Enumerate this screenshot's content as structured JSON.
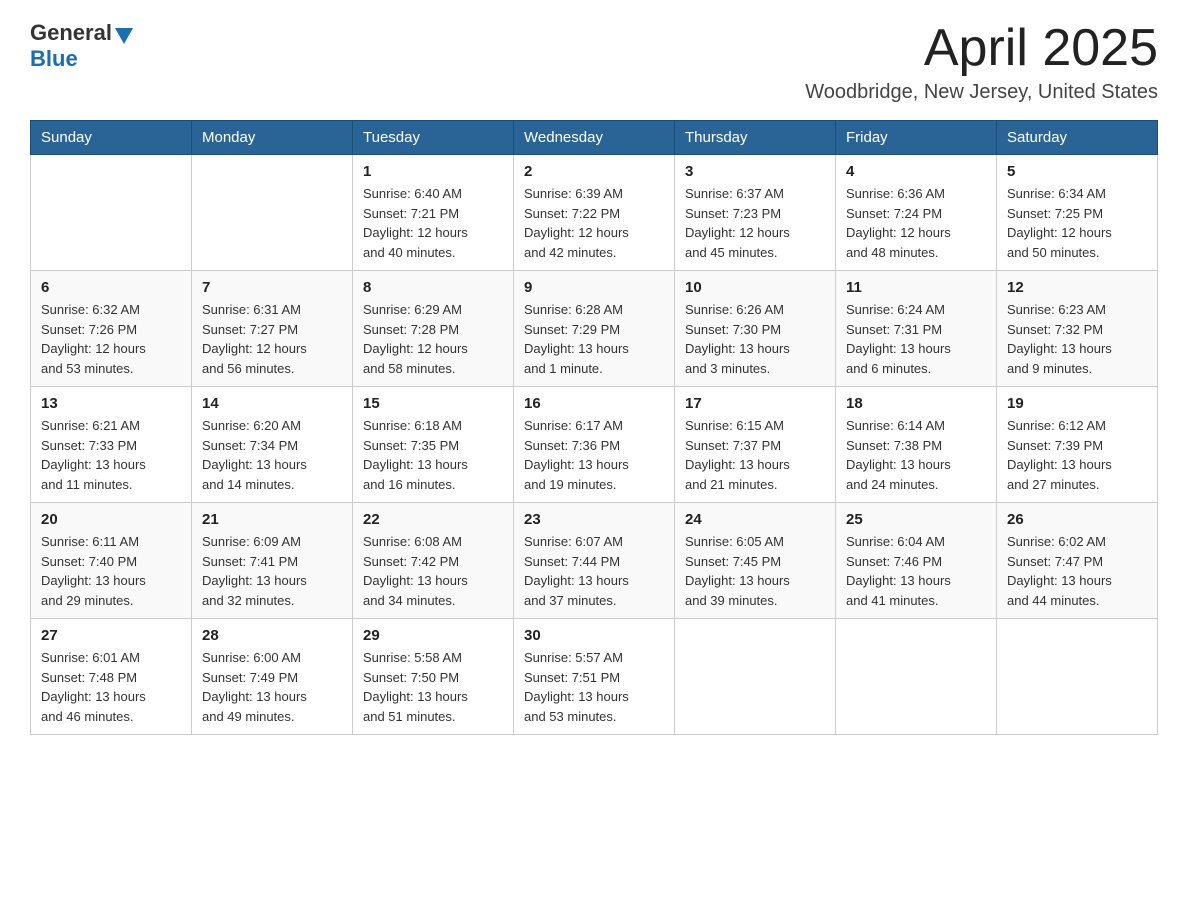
{
  "header": {
    "logo_general": "General",
    "logo_blue": "Blue",
    "title": "April 2025",
    "subtitle": "Woodbridge, New Jersey, United States"
  },
  "days_of_week": [
    "Sunday",
    "Monday",
    "Tuesday",
    "Wednesday",
    "Thursday",
    "Friday",
    "Saturday"
  ],
  "weeks": [
    [
      {
        "day": "",
        "info": ""
      },
      {
        "day": "",
        "info": ""
      },
      {
        "day": "1",
        "info": "Sunrise: 6:40 AM\nSunset: 7:21 PM\nDaylight: 12 hours\nand 40 minutes."
      },
      {
        "day": "2",
        "info": "Sunrise: 6:39 AM\nSunset: 7:22 PM\nDaylight: 12 hours\nand 42 minutes."
      },
      {
        "day": "3",
        "info": "Sunrise: 6:37 AM\nSunset: 7:23 PM\nDaylight: 12 hours\nand 45 minutes."
      },
      {
        "day": "4",
        "info": "Sunrise: 6:36 AM\nSunset: 7:24 PM\nDaylight: 12 hours\nand 48 minutes."
      },
      {
        "day": "5",
        "info": "Sunrise: 6:34 AM\nSunset: 7:25 PM\nDaylight: 12 hours\nand 50 minutes."
      }
    ],
    [
      {
        "day": "6",
        "info": "Sunrise: 6:32 AM\nSunset: 7:26 PM\nDaylight: 12 hours\nand 53 minutes."
      },
      {
        "day": "7",
        "info": "Sunrise: 6:31 AM\nSunset: 7:27 PM\nDaylight: 12 hours\nand 56 minutes."
      },
      {
        "day": "8",
        "info": "Sunrise: 6:29 AM\nSunset: 7:28 PM\nDaylight: 12 hours\nand 58 minutes."
      },
      {
        "day": "9",
        "info": "Sunrise: 6:28 AM\nSunset: 7:29 PM\nDaylight: 13 hours\nand 1 minute."
      },
      {
        "day": "10",
        "info": "Sunrise: 6:26 AM\nSunset: 7:30 PM\nDaylight: 13 hours\nand 3 minutes."
      },
      {
        "day": "11",
        "info": "Sunrise: 6:24 AM\nSunset: 7:31 PM\nDaylight: 13 hours\nand 6 minutes."
      },
      {
        "day": "12",
        "info": "Sunrise: 6:23 AM\nSunset: 7:32 PM\nDaylight: 13 hours\nand 9 minutes."
      }
    ],
    [
      {
        "day": "13",
        "info": "Sunrise: 6:21 AM\nSunset: 7:33 PM\nDaylight: 13 hours\nand 11 minutes."
      },
      {
        "day": "14",
        "info": "Sunrise: 6:20 AM\nSunset: 7:34 PM\nDaylight: 13 hours\nand 14 minutes."
      },
      {
        "day": "15",
        "info": "Sunrise: 6:18 AM\nSunset: 7:35 PM\nDaylight: 13 hours\nand 16 minutes."
      },
      {
        "day": "16",
        "info": "Sunrise: 6:17 AM\nSunset: 7:36 PM\nDaylight: 13 hours\nand 19 minutes."
      },
      {
        "day": "17",
        "info": "Sunrise: 6:15 AM\nSunset: 7:37 PM\nDaylight: 13 hours\nand 21 minutes."
      },
      {
        "day": "18",
        "info": "Sunrise: 6:14 AM\nSunset: 7:38 PM\nDaylight: 13 hours\nand 24 minutes."
      },
      {
        "day": "19",
        "info": "Sunrise: 6:12 AM\nSunset: 7:39 PM\nDaylight: 13 hours\nand 27 minutes."
      }
    ],
    [
      {
        "day": "20",
        "info": "Sunrise: 6:11 AM\nSunset: 7:40 PM\nDaylight: 13 hours\nand 29 minutes."
      },
      {
        "day": "21",
        "info": "Sunrise: 6:09 AM\nSunset: 7:41 PM\nDaylight: 13 hours\nand 32 minutes."
      },
      {
        "day": "22",
        "info": "Sunrise: 6:08 AM\nSunset: 7:42 PM\nDaylight: 13 hours\nand 34 minutes."
      },
      {
        "day": "23",
        "info": "Sunrise: 6:07 AM\nSunset: 7:44 PM\nDaylight: 13 hours\nand 37 minutes."
      },
      {
        "day": "24",
        "info": "Sunrise: 6:05 AM\nSunset: 7:45 PM\nDaylight: 13 hours\nand 39 minutes."
      },
      {
        "day": "25",
        "info": "Sunrise: 6:04 AM\nSunset: 7:46 PM\nDaylight: 13 hours\nand 41 minutes."
      },
      {
        "day": "26",
        "info": "Sunrise: 6:02 AM\nSunset: 7:47 PM\nDaylight: 13 hours\nand 44 minutes."
      }
    ],
    [
      {
        "day": "27",
        "info": "Sunrise: 6:01 AM\nSunset: 7:48 PM\nDaylight: 13 hours\nand 46 minutes."
      },
      {
        "day": "28",
        "info": "Sunrise: 6:00 AM\nSunset: 7:49 PM\nDaylight: 13 hours\nand 49 minutes."
      },
      {
        "day": "29",
        "info": "Sunrise: 5:58 AM\nSunset: 7:50 PM\nDaylight: 13 hours\nand 51 minutes."
      },
      {
        "day": "30",
        "info": "Sunrise: 5:57 AM\nSunset: 7:51 PM\nDaylight: 13 hours\nand 53 minutes."
      },
      {
        "day": "",
        "info": ""
      },
      {
        "day": "",
        "info": ""
      },
      {
        "day": "",
        "info": ""
      }
    ]
  ]
}
